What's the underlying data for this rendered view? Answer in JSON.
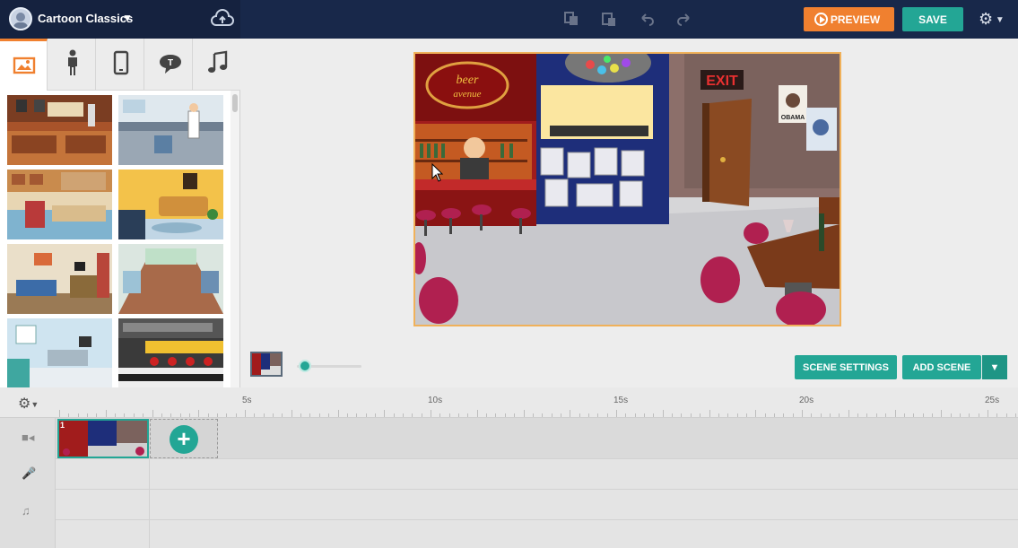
{
  "project": {
    "title": "Cartoon Classics"
  },
  "toolbar": {
    "preview_label": "PREVIEW",
    "save_label": "SAVE"
  },
  "library": {
    "tabs": [
      "backgrounds",
      "characters",
      "props",
      "text",
      "audio"
    ],
    "active_tab": "backgrounds"
  },
  "stage": {
    "scene_sign": "beer",
    "exit_sign": "EXIT",
    "poster_text": "OBAMA"
  },
  "scene_controls": {
    "settings_label": "SCENE SETTINGS",
    "add_label": "ADD SCENE"
  },
  "timeline": {
    "ticks": [
      "5s",
      "10s",
      "15s",
      "20s",
      "25s"
    ],
    "scene_number": "1"
  },
  "colors": {
    "accent_orange": "#f0802f",
    "accent_teal": "#23a695",
    "topbar": "#18284a"
  }
}
